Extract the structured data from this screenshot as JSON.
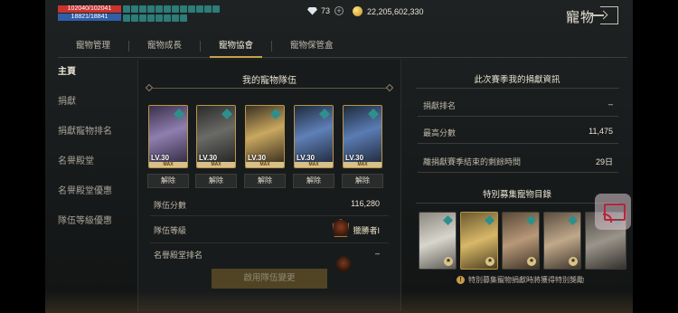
{
  "hud": {
    "hp": "102040/102041",
    "mp": "18821/18841"
  },
  "currency": {
    "gems": "73",
    "gold": "22,205,602,330"
  },
  "header": {
    "title": "寵物"
  },
  "tabs": [
    {
      "label": "寵物管理",
      "active": false
    },
    {
      "label": "寵物成長",
      "active": false
    },
    {
      "label": "寵物協會",
      "active": true
    },
    {
      "label": "寵物保管盒",
      "active": false
    }
  ],
  "sidebar": {
    "items": [
      {
        "label": "主頁",
        "active": true
      },
      {
        "label": "捐獻"
      },
      {
        "label": "捐獻寵物排名"
      },
      {
        "label": "名譽殿堂"
      },
      {
        "label": "名譽殿堂優惠"
      },
      {
        "label": "隊伍等級優惠"
      }
    ]
  },
  "team": {
    "title": "我的寵物隊伍",
    "pets": [
      {
        "level": "LV.30",
        "max": "MAX",
        "release": "解除"
      },
      {
        "level": "LV.30",
        "max": "MAX",
        "release": "解除"
      },
      {
        "level": "LV.30",
        "max": "MAX",
        "release": "解除"
      },
      {
        "level": "LV.30",
        "max": "MAX",
        "release": "解除"
      },
      {
        "level": "LV.30",
        "max": "MAX",
        "release": "解除"
      }
    ],
    "score_label": "隊伍分數",
    "score_value": "116,280",
    "level_label": "隊伍等級",
    "level_value": "獵勝者I",
    "rank_label": "名譽殿堂排名",
    "rank_value": "–",
    "apply_label": "啟用隊伍變更"
  },
  "donation": {
    "title": "此次賽季我的捐獻資訊",
    "rank_label": "捐獻排名",
    "rank_value": "–",
    "best_label": "最高分數",
    "best_value": "11,475",
    "time_label": "離捐獻賽季結束的剩餘時間",
    "time_value": "29日"
  },
  "collection": {
    "title": "特別募集寵物目錄",
    "notice": "特別募集寵物捐獻時將獲得特別獎勵"
  },
  "colors": {
    "accent": "#c8a04a",
    "hp": "#c9342f",
    "mp": "#2f5fa8",
    "tag": "#2e8f8c"
  }
}
